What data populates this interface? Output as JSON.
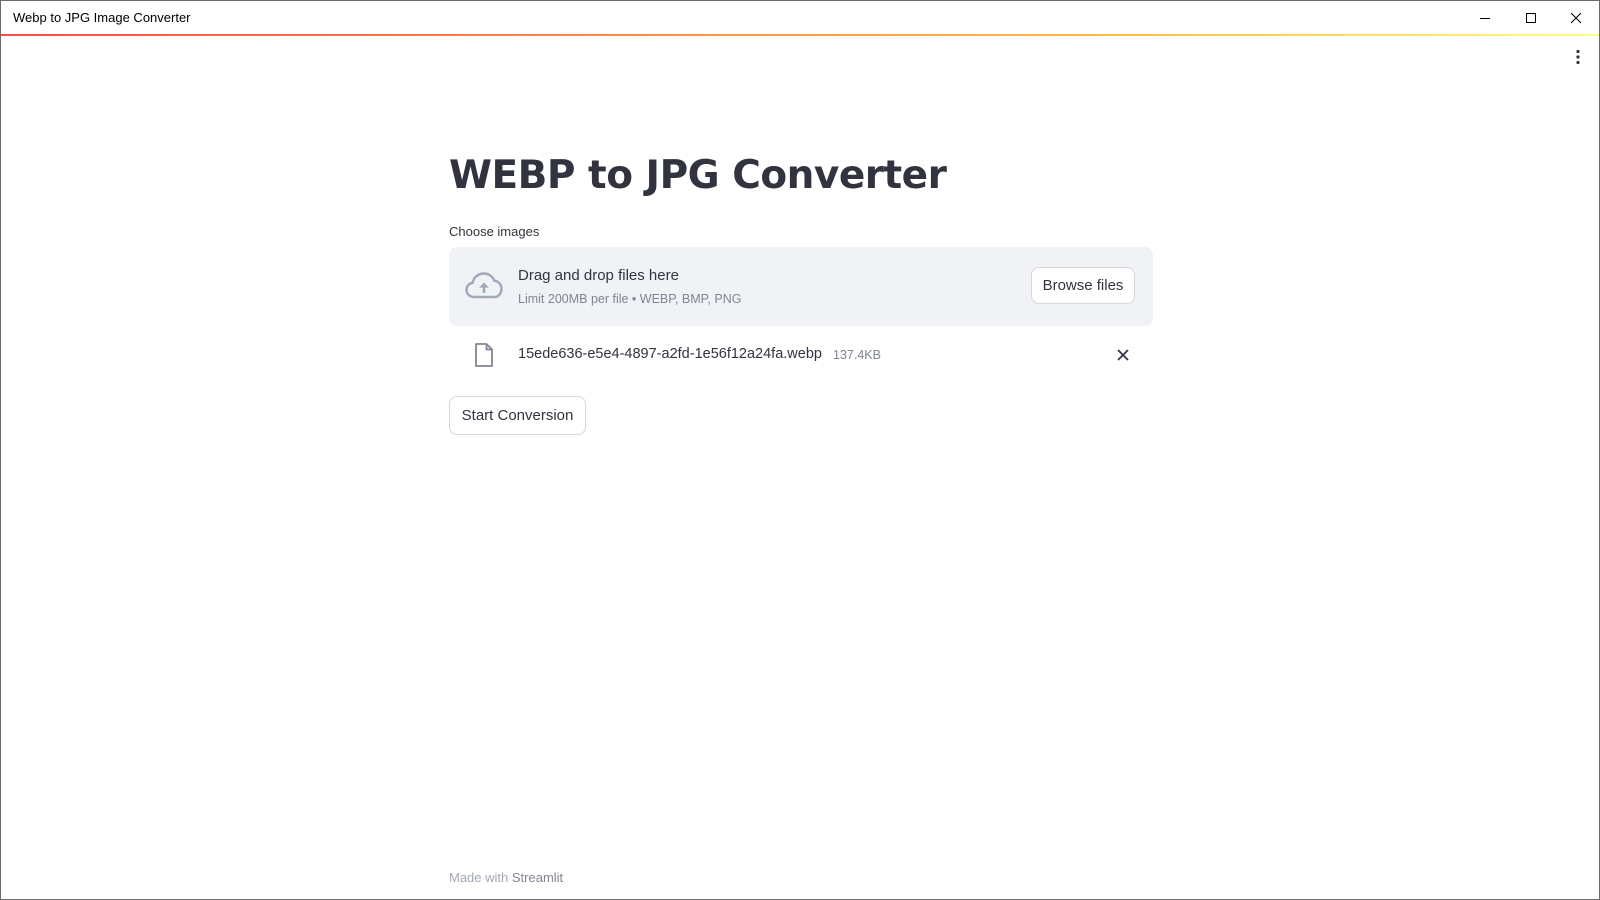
{
  "window": {
    "title": "Webp to JPG Image Converter"
  },
  "colors": {
    "accent": "#ff4b4b",
    "text": "#31333f",
    "muted": "#808495",
    "dropzone_bg": "#f0f2f6"
  },
  "header": {
    "menu_icon": "kebab-menu-icon"
  },
  "main": {
    "title": "WEBP to JPG Converter",
    "uploader": {
      "label": "Choose images",
      "drop_text": "Drag and drop files here",
      "limit_text": "Limit 200MB per file • WEBP, BMP, PNG",
      "browse_label": "Browse files",
      "icon": "cloud-upload-icon"
    },
    "files": [
      {
        "name": "15ede636-e5e4-4897-a2fd-1e56f12a24fa.webp",
        "size": "137.4KB",
        "icon": "file-icon"
      }
    ],
    "start_button": "Start Conversion"
  },
  "footer": {
    "prefix": "Made with",
    "brand": "Streamlit"
  }
}
